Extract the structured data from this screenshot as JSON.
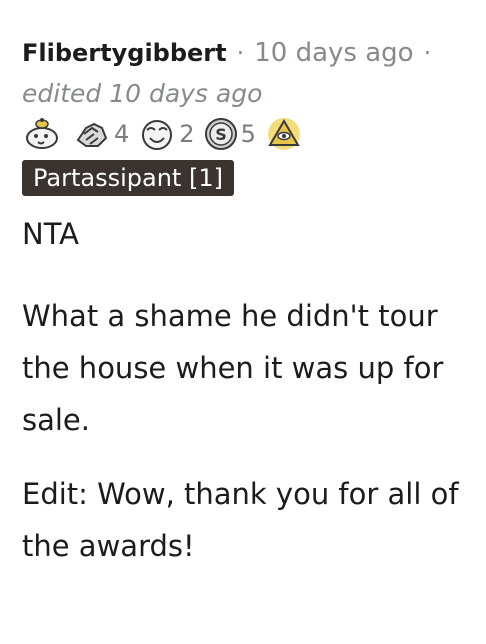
{
  "comment": {
    "username": "Flibertygibbert",
    "separator": "·",
    "timestamp": "10 days ago",
    "edited": "edited 10 days ago",
    "flair": "Partassipant [1]",
    "awards": [
      {
        "icon": "wholesome-seal-icon",
        "count": ""
      },
      {
        "icon": "handshake-award-icon",
        "count": "4"
      },
      {
        "icon": "wholesome-face-award-icon",
        "count": "2"
      },
      {
        "icon": "silver-award-icon",
        "count": "5"
      },
      {
        "icon": "gold-eye-award-icon",
        "count": ""
      }
    ],
    "body": [
      "NTA",
      "What a shame he didn't tour the house when it was up for sale.",
      "Edit: Wow, thank you for all of the awards!"
    ]
  },
  "colors": {
    "text": "#1c1c1c",
    "meta": "#878a8c",
    "flair_bg": "#3a3330",
    "flair_text": "#ffffff",
    "gold": "#e8c44a"
  }
}
